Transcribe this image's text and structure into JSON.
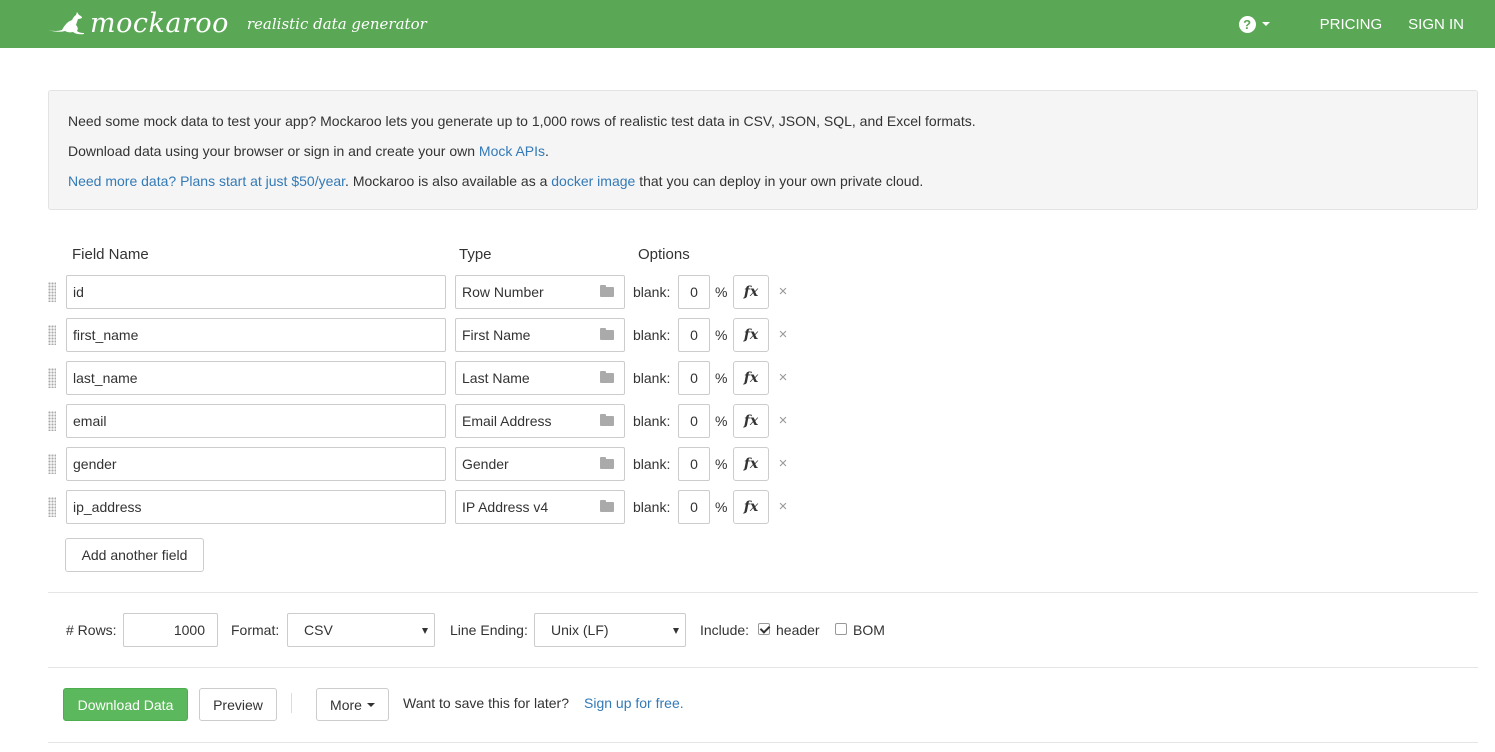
{
  "navbar": {
    "brand_name": "mockaroo",
    "tagline": "realistic data generator",
    "help_symbol": "?",
    "pricing": "PRICING",
    "sign_in": "SIGN IN",
    "background": "#5aa755"
  },
  "info": {
    "line1": "Need some mock data to test your app? Mockaroo lets you generate up to 1,000 rows of realistic test data in CSV, JSON, SQL, and Excel formats.",
    "line2_prefix": "Download data using your browser or sign in and create your own ",
    "line2_link": "Mock APIs",
    "line2_suffix": ".",
    "line3_link1": "Need more data? Plans start at just $50/year",
    "line3_mid": ". Mockaroo is also available as a ",
    "line3_link2": "docker image",
    "line3_suffix": " that you can deploy in your own private cloud."
  },
  "fields": {
    "headers": {
      "name": "Field Name",
      "type": "Type",
      "options": "Options"
    },
    "blank_label": "blank:",
    "percent": "%",
    "fx": "fx",
    "remove": "×",
    "rows": [
      {
        "name": "id",
        "type": "Row Number",
        "blank": "0"
      },
      {
        "name": "first_name",
        "type": "First Name",
        "blank": "0"
      },
      {
        "name": "last_name",
        "type": "Last Name",
        "blank": "0"
      },
      {
        "name": "email",
        "type": "Email Address",
        "blank": "0"
      },
      {
        "name": "gender",
        "type": "Gender",
        "blank": "0"
      },
      {
        "name": "ip_address",
        "type": "IP Address v4",
        "blank": "0"
      }
    ],
    "add_button": "Add another field"
  },
  "options": {
    "rows_label": "# Rows:",
    "rows_value": "1000",
    "format_label": "Format:",
    "format_value": "CSV",
    "line_ending_label": "Line Ending:",
    "line_ending_value": "Unix (LF)",
    "include_label": "Include:",
    "header_label": "header",
    "header_checked": true,
    "bom_label": "BOM",
    "bom_checked": false
  },
  "actions": {
    "download": "Download Data",
    "preview": "Preview",
    "more": "More",
    "save_prompt": "Want to save this for later?",
    "signup_link": "Sign up for free.",
    "primary_color": "#5cb85c"
  }
}
